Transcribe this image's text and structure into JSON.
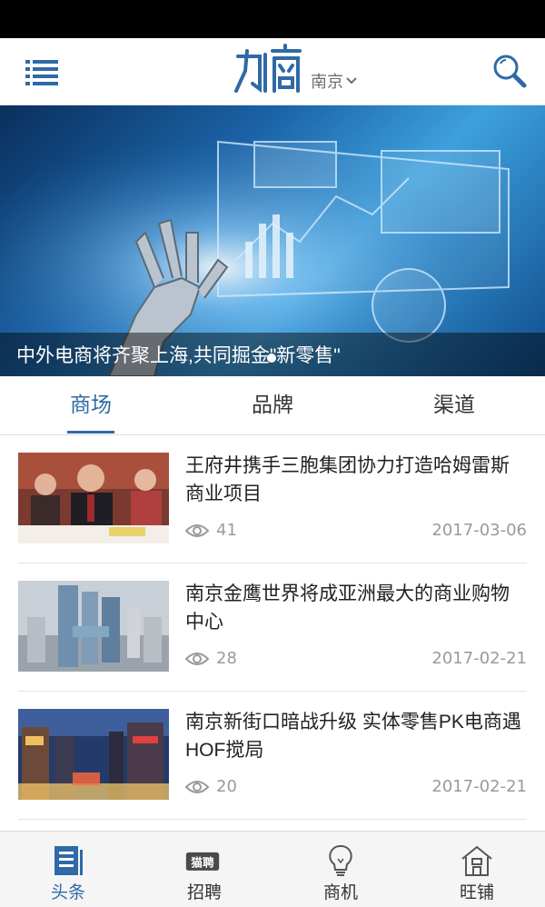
{
  "header": {
    "logo_text": "力商",
    "city": "南京",
    "menu_icon": "list-menu-icon",
    "search_icon": "search-icon"
  },
  "banner": {
    "caption": "中外电商将齐聚上海,共同掘金\"新零售\"",
    "active_dot": 1
  },
  "tabs": [
    {
      "label": "商场",
      "active": true
    },
    {
      "label": "品牌",
      "active": false
    },
    {
      "label": "渠道",
      "active": false
    }
  ],
  "news": [
    {
      "title": "王府井携手三胞集团协力打造哈姆雷斯商业项目",
      "views": "41",
      "date": "2017-03-06"
    },
    {
      "title": "南京金鹰世界将成亚洲最大的商业购物中心",
      "views": "28",
      "date": "2017-02-21"
    },
    {
      "title": "南京新街口暗战升级 实体零售PK电商遇HOF搅局",
      "views": "20",
      "date": "2017-02-21"
    }
  ],
  "bottom_nav": [
    {
      "label": "头条",
      "icon": "news-icon",
      "active": true
    },
    {
      "label": "招聘",
      "icon": "recruit-icon",
      "badge_text": "猫聘",
      "active": false
    },
    {
      "label": "商机",
      "icon": "lightbulb-icon",
      "active": false
    },
    {
      "label": "旺铺",
      "icon": "shop-icon",
      "active": false
    }
  ],
  "colors": {
    "accent": "#2f6aa6",
    "text": "#222222",
    "muted": "#9a9a9a"
  }
}
